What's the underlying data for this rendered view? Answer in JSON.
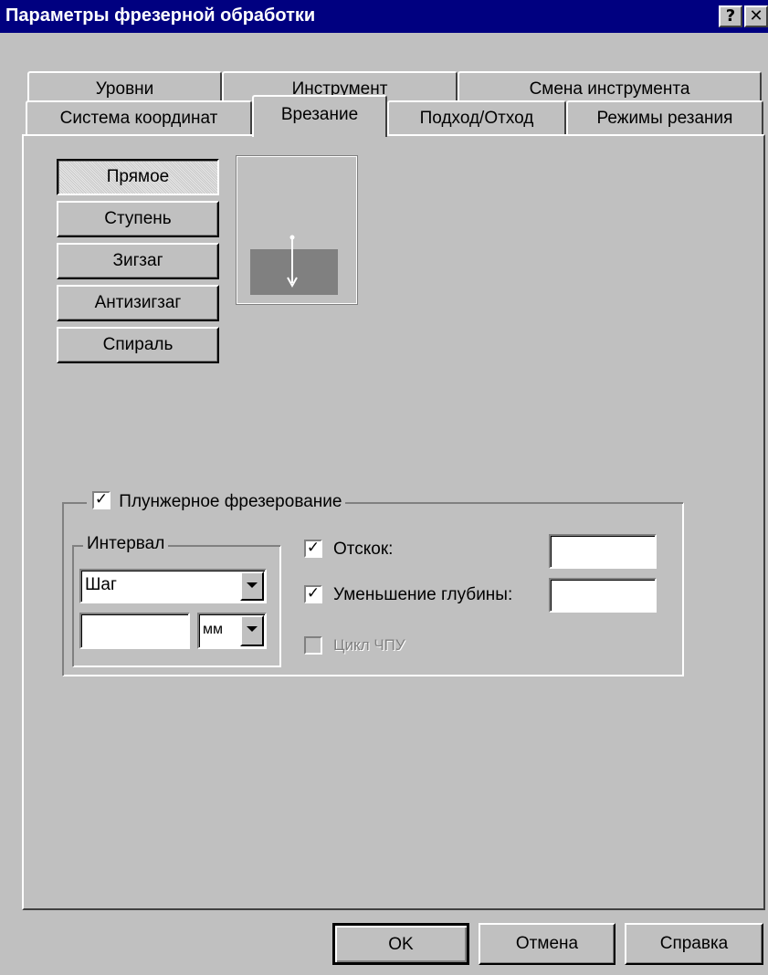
{
  "window": {
    "title": "Параметры фрезерной обработки",
    "help_label": "?",
    "close_label": "✕"
  },
  "tabs": {
    "row1": [
      "Уровни",
      "Инструмент",
      "Смена инструмента"
    ],
    "row2": [
      "Система координат",
      "Врезание",
      "Подход/Отход",
      "Режимы резания"
    ],
    "active": "Врезание"
  },
  "entry_types": {
    "buttons": [
      "Прямое",
      "Ступень",
      "Зигзаг",
      "Антизигзаг",
      "Спираль"
    ],
    "selected": "Прямое"
  },
  "preview": {
    "description": "",
    "block_color": "#808080",
    "tool_color": "#ffffff"
  },
  "plunge": {
    "checkbox_label": "Плунжерное фрезерование",
    "checked": true,
    "interval": {
      "legend": "Интервал",
      "mode_value": "Шаг",
      "step_value": "",
      "unit_value": "мм"
    },
    "retract": {
      "label": "Отскок:",
      "checked": true,
      "value": ""
    },
    "depth_reduction": {
      "label": "Уменьшение глубины:",
      "checked": true,
      "value": ""
    },
    "cnc_cycle": {
      "label": "Цикл ЧПУ",
      "checked": false,
      "enabled": false
    }
  },
  "footer": {
    "ok_label": "OK",
    "cancel_label": "Отмена",
    "help_label": "Справка"
  }
}
